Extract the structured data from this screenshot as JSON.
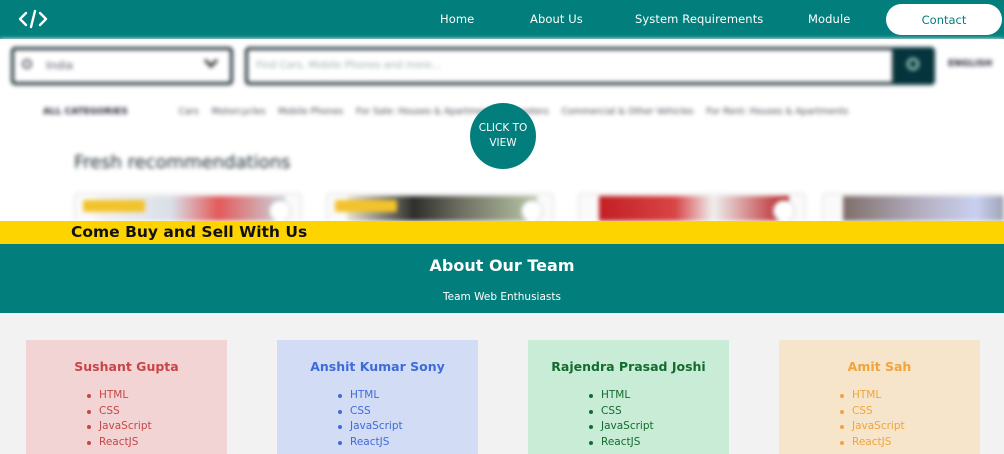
{
  "navbar": {
    "logo_alt": "code-brackets",
    "links": [
      "Home",
      "About Us",
      "System Requirements",
      "Module"
    ],
    "contact": "Contact"
  },
  "background_site": {
    "location_value": "India",
    "search_placeholder": "Find Cars, Mobile Phones and more...",
    "language": "ENGLISH",
    "all_categories": "ALL CATEGORIES",
    "categories": [
      "Cars",
      "Motorcycles",
      "Mobile Phones",
      "For Sale: Houses & Apartments",
      "Scooters",
      "Commercial & Other Vehicles",
      "For Rent: Houses & Apartments"
    ],
    "recommendations_title": "Fresh recommendations",
    "featured_label": "FEATURED"
  },
  "cta": {
    "line1": "CLICK TO",
    "line2": "VIEW"
  },
  "banner": {
    "text": "Come Buy and Sell With Us"
  },
  "team": {
    "title": "About Our Team",
    "subtitle": "Team Web Enthusiasts",
    "members": [
      {
        "name": "Sushant Gupta",
        "skills": [
          "HTML",
          "CSS",
          "JavaScript",
          "ReactJS"
        ],
        "bg": "#f2d4d4",
        "color": "#c94545"
      },
      {
        "name": "Anshit Kumar Sony",
        "skills": [
          "HTML",
          "CSS",
          "JavaScript",
          "ReactJS"
        ],
        "bg": "#d3dcf5",
        "color": "#3f6bd8"
      },
      {
        "name": "Rajendra Prasad Joshi",
        "skills": [
          "HTML",
          "CSS",
          "JavaScript",
          "ReactJS"
        ],
        "bg": "#c8ecd5",
        "color": "#146b2e"
      },
      {
        "name": "Amit Sah",
        "skills": [
          "HTML",
          "CSS",
          "JavaScript",
          "ReactJS"
        ],
        "bg": "#f6e5cb",
        "color": "#f0a43a"
      }
    ]
  },
  "colors": {
    "primary": "#027f7c",
    "banner": "#fed400"
  }
}
